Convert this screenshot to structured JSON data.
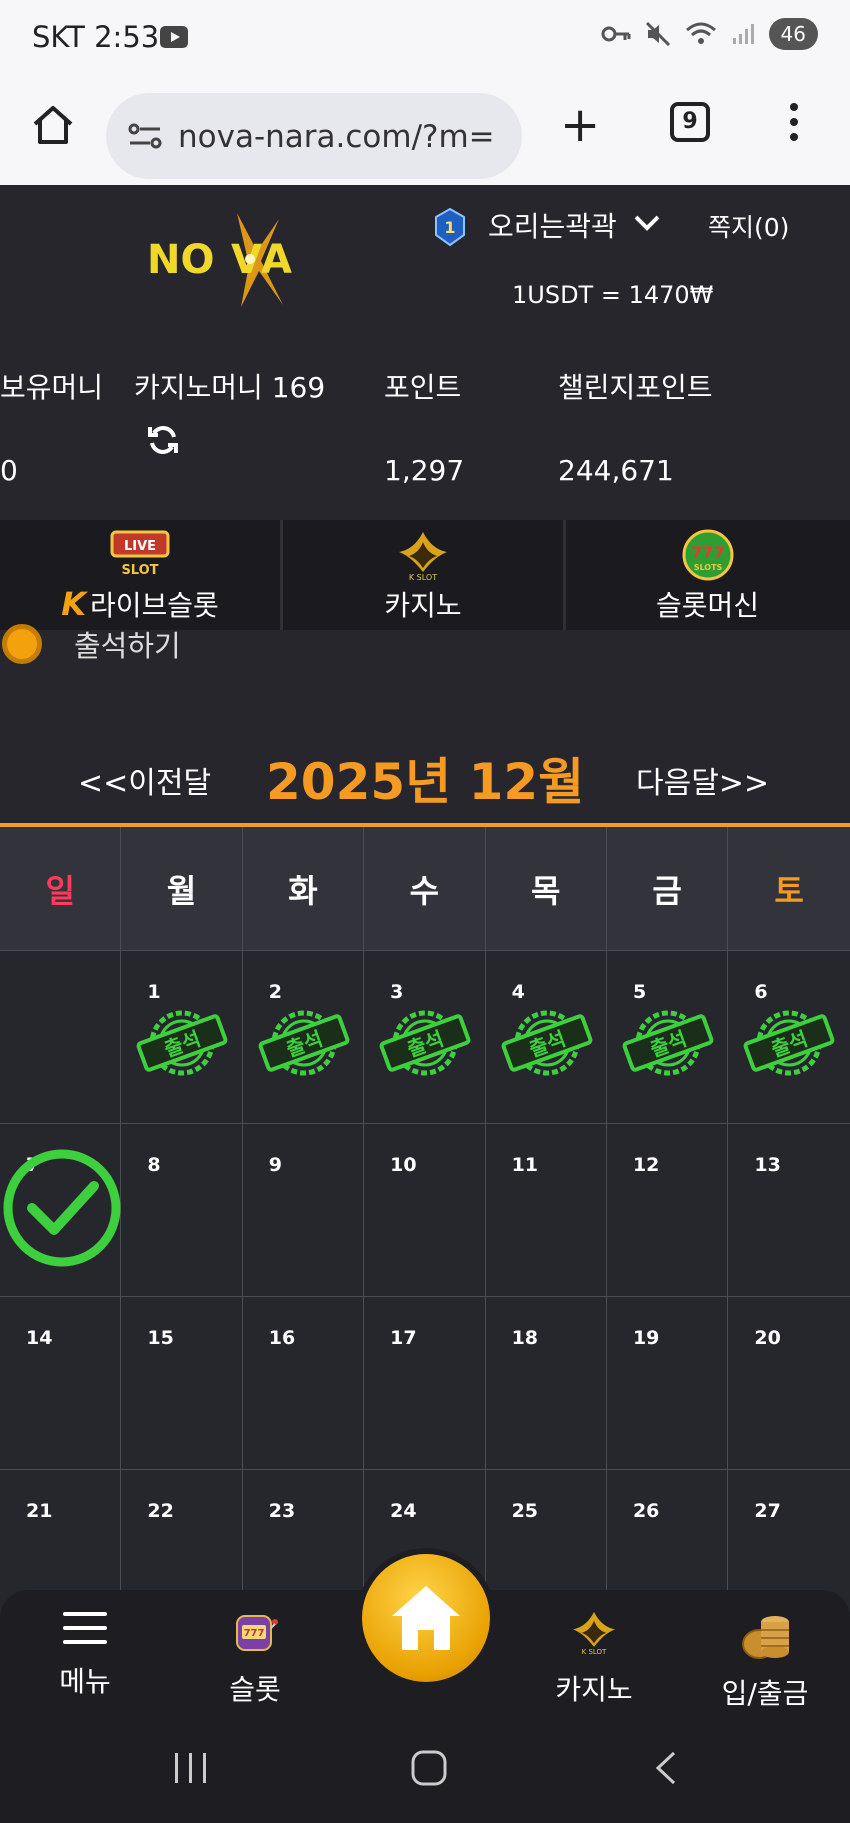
{
  "status_bar": {
    "carrier_time": "SKT 2:53",
    "battery": "46"
  },
  "browser": {
    "url": "nova-nara.com/?m=",
    "tab_count": "9"
  },
  "header": {
    "logo_text": "NOVA",
    "username": "오리는곽곽",
    "messages": "쪽지(0)",
    "exchange_rate": "1USDT = 1470₩"
  },
  "balances": {
    "holding_label": "보유머니",
    "holding_value": "0",
    "casino_label": "카지노머니 169",
    "point_label": "포인트",
    "point_value": "1,297",
    "challenge_label": "챌린지포인트",
    "challenge_value": "244,671"
  },
  "game_tabs": [
    {
      "label": "라이브슬롯",
      "icon": "live-slot-icon"
    },
    {
      "label": "카지노",
      "icon": "k-slot-icon"
    },
    {
      "label": "슬롯머신",
      "icon": "777-slots-icon"
    }
  ],
  "attendance": {
    "title": "출석하기"
  },
  "calendar": {
    "prev_label": "<<이전달",
    "month_title": "2025년 12월",
    "next_label": "다음달>>",
    "weekdays": [
      "일",
      "월",
      "화",
      "수",
      "목",
      "금",
      "토"
    ],
    "weekday_colors": [
      "#ff3b5c",
      "#ffffff",
      "#ffffff",
      "#ffffff",
      "#ffffff",
      "#ffffff",
      "#f59a22"
    ],
    "stamp_text": "출석",
    "weeks": [
      [
        "",
        "1",
        "2",
        "3",
        "4",
        "5",
        "6"
      ],
      [
        "7",
        "8",
        "9",
        "10",
        "11",
        "12",
        "13"
      ],
      [
        "14",
        "15",
        "16",
        "17",
        "18",
        "19",
        "20"
      ],
      [
        "21",
        "22",
        "23",
        "24",
        "25",
        "26",
        "27"
      ]
    ],
    "attended_days": [
      "1",
      "2",
      "3",
      "4",
      "5",
      "6"
    ],
    "checked_day": "7"
  },
  "bottom_nav": {
    "menu": "메뉴",
    "slot": "슬롯",
    "casino": "카지노",
    "deposit": "입/출금"
  },
  "colors": {
    "accent": "#f59a22",
    "stamp_green": "#3ecf3e"
  }
}
